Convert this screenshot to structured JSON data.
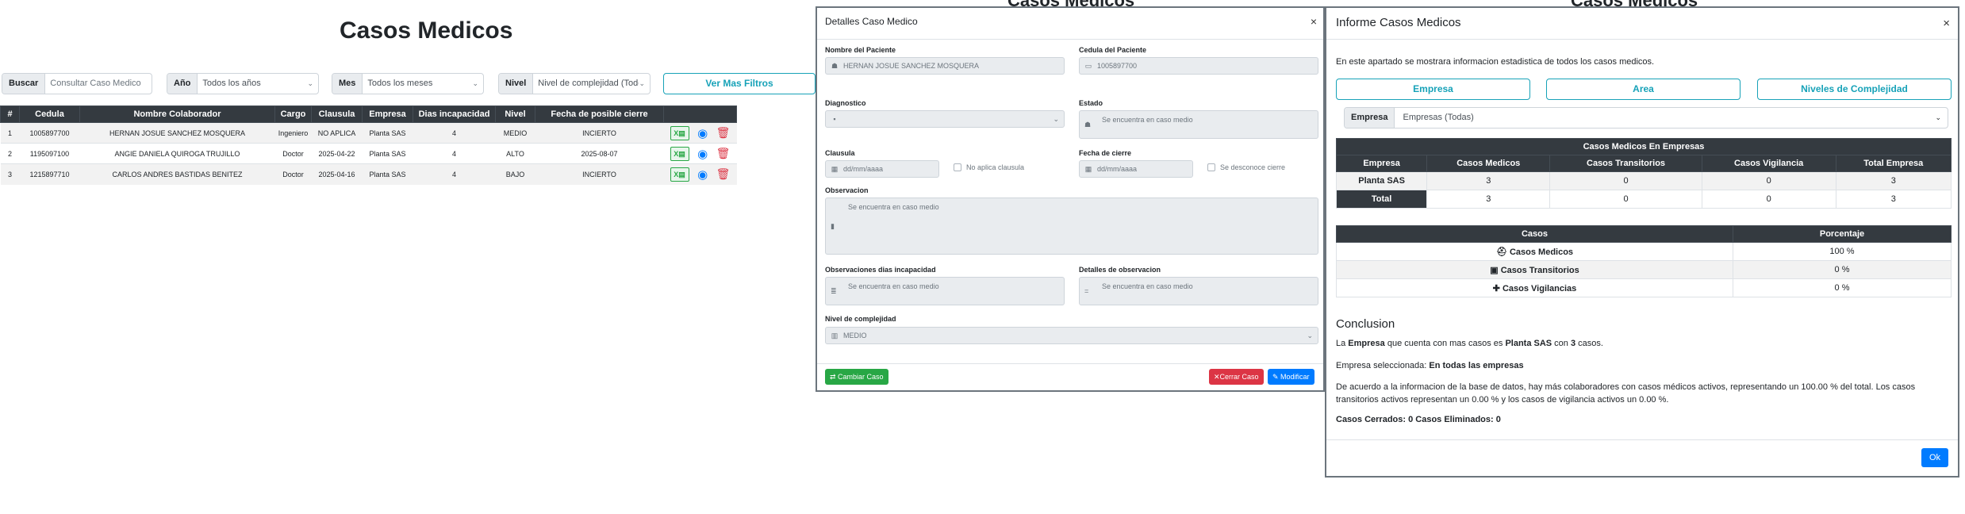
{
  "page": {
    "title": "Casos Medicos",
    "ghost_title_1": "Casos Medicos",
    "ghost_title_2": "Casos Medicos"
  },
  "filters": {
    "buscar_label": "Buscar",
    "buscar_placeholder": "Consultar Caso Medico",
    "anio_label": "Año",
    "anio_value": "Todos los años",
    "mes_label": "Mes",
    "mes_value": "Todos los meses",
    "nivel_label": "Nivel",
    "nivel_value": "Nivel de complejidad (Todo",
    "more_filters": "Ver Mas Filtros"
  },
  "table": {
    "headers": [
      "#",
      "Cedula",
      "Nombre Colaborador",
      "Cargo",
      "Clausula",
      "Empresa",
      "Dias incapacidad",
      "Nivel",
      "Fecha de posible cierre"
    ],
    "rows": [
      [
        "1",
        "1005897700",
        "HERNAN JOSUE SANCHEZ MOSQUERA",
        "Ingeniero",
        "NO APLICA",
        "Planta SAS",
        "4",
        "MEDIO",
        "INCIERTO"
      ],
      [
        "2",
        "1195097100",
        "ANGIE DANIELA QUIROGA TRUJILLO",
        "Doctor",
        "2025-04-22",
        "Planta SAS",
        "4",
        "ALTO",
        "2025-08-07"
      ],
      [
        "3",
        "1215897710",
        "CARLOS ANDRES BASTIDAS BENITEZ",
        "Doctor",
        "2025-04-16",
        "Planta SAS",
        "4",
        "BAJO",
        "INCIERTO"
      ]
    ]
  },
  "icons": {
    "excel": "file-excel-icon",
    "view": "eye-icon",
    "delete": "trash-icon"
  },
  "modal_detail": {
    "title": "Detalles Caso Medico",
    "close": "×",
    "nombre_label": "Nombre del Paciente",
    "nombre_value": "HERNAN JOSUE SANCHEZ MOSQUERA",
    "cedula_label": "Cedula del Paciente",
    "cedula_value": "1005897700",
    "diagnostico_label": "Diagnostico",
    "estado_label": "Estado",
    "estado_value": "Se encuentra en caso medio",
    "clausula_label": "Clausula",
    "clausula_placeholder": "dd/mm/aaaa",
    "no_aplica": "No aplica clausula",
    "fecha_cierre_label": "Fecha de cierre",
    "fecha_cierre_placeholder": "dd/mm/aaaa",
    "se_desconoce": "Se desconoce cierre",
    "observacion_label": "Observacion",
    "observacion_value": "Se encuentra en caso medio",
    "obs_dias_label": "Observaciones dias incapacidad",
    "obs_dias_value": "Se encuentra en caso medio",
    "detalles_obs_label": "Detalles de observacion",
    "detalles_obs_value": "Se encuentra en caso medio",
    "nivel_label": "Nivel de complejidad",
    "nivel_value": "MEDIO",
    "cambiar_caso": "Cambiar Caso",
    "cerrar_caso": "Cerrar Caso",
    "modificar": "Modificar"
  },
  "modal_report": {
    "title": "Informe Casos Medicos",
    "close": "×",
    "intro": "En este apartado se mostrara informacion estadistica de todos los casos medicos.",
    "tab_empresa": "Empresa",
    "tab_area": "Area",
    "tab_niveles": "Niveles de Complejidad",
    "empresa_label": "Empresa",
    "empresa_value": "Empresas (Todas)",
    "t1_title": "Casos Medicos En Empresas",
    "t1_headers": [
      "Empresa",
      "Casos Medicos",
      "Casos Transitorios",
      "Casos Vigilancia",
      "Total Empresa"
    ],
    "t1_rows": [
      [
        "Planta SAS",
        "3",
        "0",
        "0",
        "3"
      ],
      [
        "Total",
        "3",
        "0",
        "0",
        "3"
      ]
    ],
    "t2_headers": [
      "Casos",
      "Porcentaje"
    ],
    "t2_rows": [
      [
        "Casos Medicos",
        "100 %"
      ],
      [
        "Casos Transitorios",
        "0 %"
      ],
      [
        "Casos Vigilancias",
        "0 %"
      ]
    ],
    "conclusion_title": "Conclusion",
    "c1_a": "La ",
    "c1_b": "Empresa",
    "c1_c": " que cuenta con mas casos es ",
    "c1_d": "Planta SAS",
    "c1_e": " con ",
    "c1_f": "3",
    "c1_g": " casos.",
    "c2_a": "Empresa seleccionada: ",
    "c2_b": "En todas las empresas",
    "c3": "De acuerdo a la informacion de la base de datos, hay más colaboradores con casos médicos activos, representando un 100.00 % del total. Los casos transitorios activos representan un 0.00 % y los casos de vigilancia activos un 0.00 %.",
    "c4": "Casos Cerrados: 0 Casos Eliminados: 0",
    "ok": "Ok"
  }
}
